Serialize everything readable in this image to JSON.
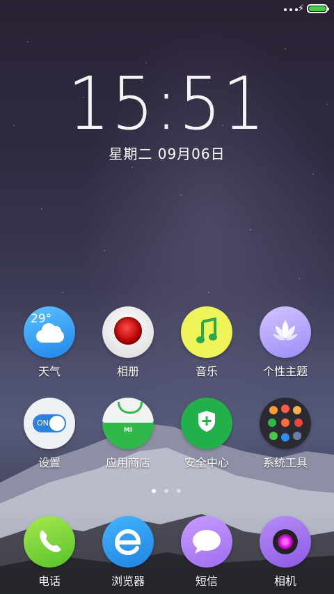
{
  "status_bar": {
    "signal_icon": "three-dots-signal-icon",
    "charging_icon": "lightning-icon",
    "battery_icon": "battery-full-icon",
    "battery_color": "#3dd13a"
  },
  "lockclock": {
    "time": "15:51",
    "date": "星期二  09月06日"
  },
  "apps": [
    {
      "id": "weather",
      "label": "天气",
      "icon": "weather-cloud-icon",
      "temp": "29°"
    },
    {
      "id": "gallery",
      "label": "相册",
      "icon": "rose-photo-icon"
    },
    {
      "id": "music",
      "label": "音乐",
      "icon": "music-note-icon"
    },
    {
      "id": "themes",
      "label": "个性主题",
      "icon": "lotus-icon"
    },
    {
      "id": "settings",
      "label": "设置",
      "icon": "toggle-switch-icon",
      "toggle_text": "ON"
    },
    {
      "id": "appstore",
      "label": "应用商店",
      "icon": "shopping-bag-icon",
      "brand": "MI"
    },
    {
      "id": "security",
      "label": "安全中心",
      "icon": "shield-plus-icon"
    },
    {
      "id": "tools",
      "label": "系统工具",
      "icon": "folder-grid-icon"
    }
  ],
  "pager": {
    "pages": 3,
    "active": 1
  },
  "dock": [
    {
      "id": "phone",
      "label": "电话",
      "icon": "phone-handset-icon"
    },
    {
      "id": "browser",
      "label": "浏览器",
      "icon": "browser-e-icon"
    },
    {
      "id": "messages",
      "label": "短信",
      "icon": "chat-bubble-icon"
    },
    {
      "id": "camera",
      "label": "相机",
      "icon": "camera-lens-icon"
    }
  ]
}
